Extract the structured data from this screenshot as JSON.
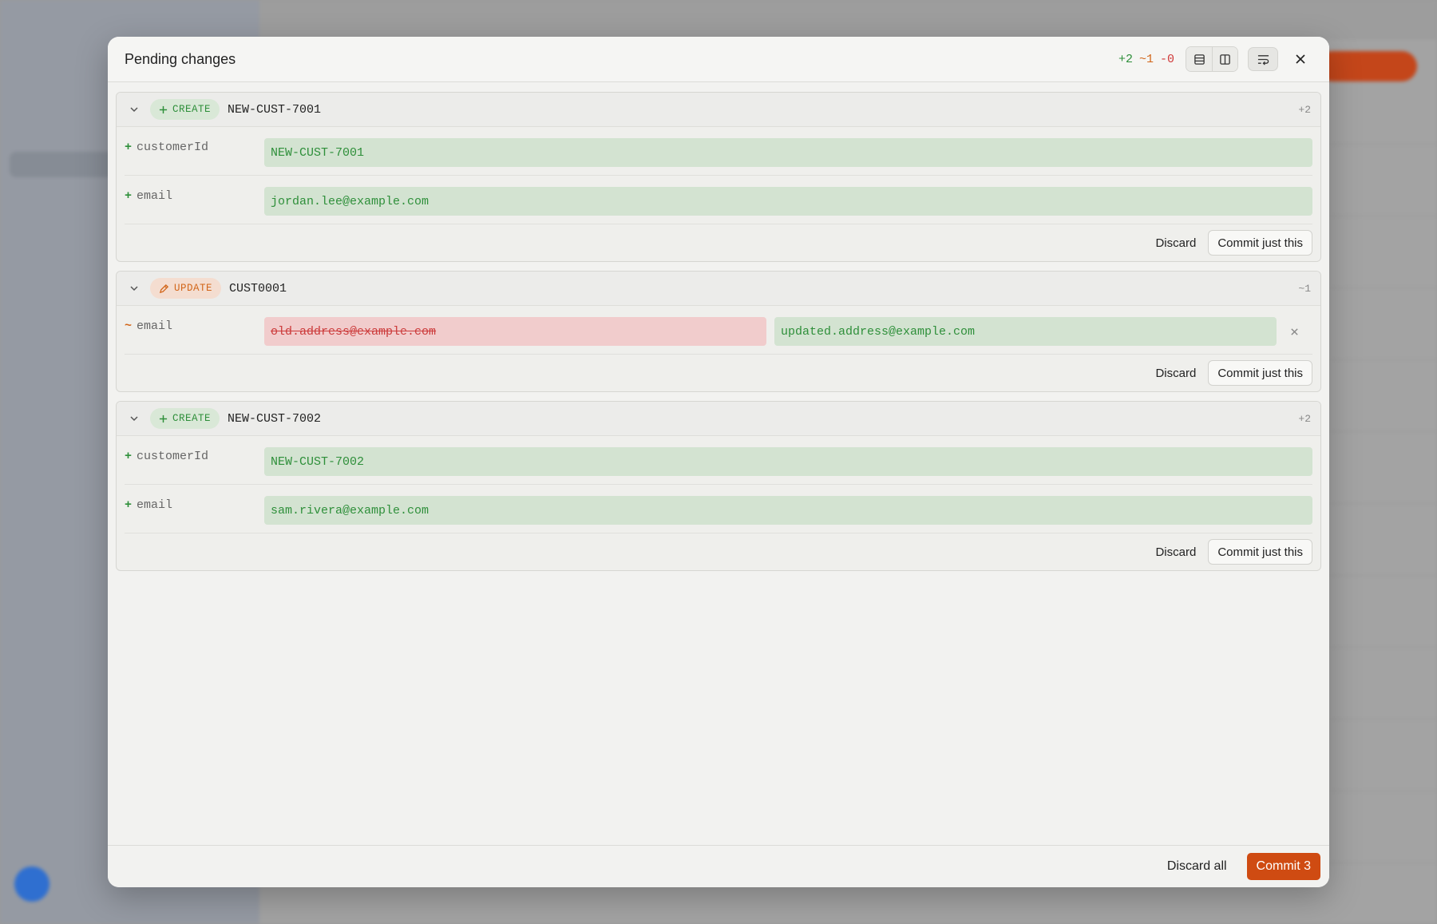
{
  "modal": {
    "title": "Pending changes",
    "counts": {
      "added": "+2",
      "modified": "~1",
      "deleted": "-0"
    }
  },
  "changes": [
    {
      "type": "CREATE",
      "record_id": "NEW-CUST-7001",
      "count": "+2",
      "fields": [
        {
          "mark": "+",
          "name": "customerId",
          "value": "NEW-CUST-7001"
        },
        {
          "mark": "+",
          "name": "email",
          "value": "jordan.lee@example.com"
        }
      ]
    },
    {
      "type": "UPDATE",
      "record_id": "CUST0001",
      "count": "~1",
      "fields": [
        {
          "mark": "~",
          "name": "email",
          "old_value": "old.address@example.com",
          "new_value": "updated.address@example.com"
        }
      ]
    },
    {
      "type": "CREATE",
      "record_id": "NEW-CUST-7002",
      "count": "+2",
      "fields": [
        {
          "mark": "+",
          "name": "customerId",
          "value": "NEW-CUST-7002"
        },
        {
          "mark": "+",
          "name": "email",
          "value": "sam.rivera@example.com"
        }
      ]
    }
  ],
  "card_actions": {
    "discard_label": "Discard",
    "commit_label": "Commit just this"
  },
  "footer": {
    "discard_all_label": "Discard all",
    "commit_all_label": "Commit 3"
  },
  "icons": {
    "chevron": "chevron-down-icon",
    "create": "plus-icon",
    "update": "pencil-icon",
    "stacked_view": "rows-view-icon",
    "split_view": "columns-view-icon",
    "wrap": "wrap-text-icon",
    "close": "close-icon",
    "revert": "close-icon"
  },
  "colors": {
    "added": "#2e8f3a",
    "modified": "#d2661a",
    "deleted": "#d03a3a",
    "primary": "#cf4b12"
  }
}
